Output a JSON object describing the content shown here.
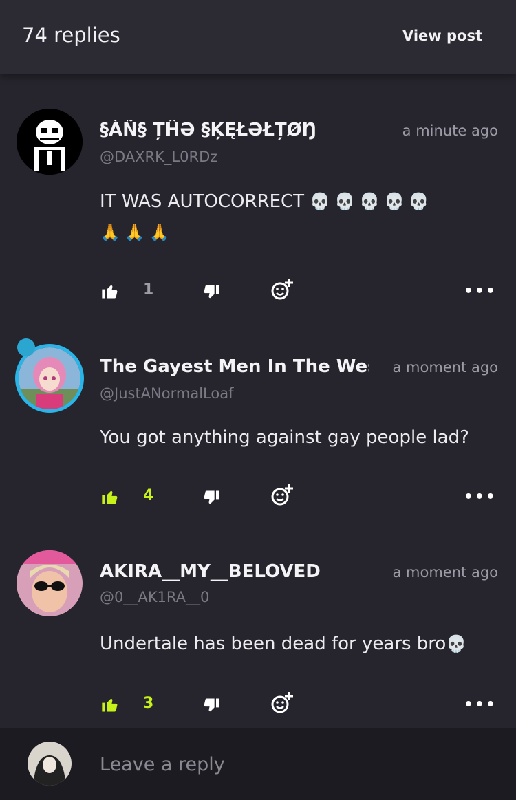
{
  "header": {
    "title": "74 replies",
    "view_post": "View post"
  },
  "comments": [
    {
      "name": "§ÀÑ§ ȚĤƏ §ĶĘŁƏŁȚØŊ",
      "handle": "@DAXRK_L0RDz",
      "time": "a minute ago",
      "text": "IT WAS AUTOCORRECT",
      "emojis_line1": [
        "💀",
        "💀",
        "💀",
        "💀",
        "💀"
      ],
      "emojis_line2": [
        "🙏",
        "🙏",
        "🙏"
      ],
      "likes": "1",
      "liked": false
    },
    {
      "name": "The Gayest Men In The West",
      "handle": "@JustANormalLoaf",
      "time": "a moment ago",
      "text": "You got anything against gay people lad?",
      "likes": "4",
      "liked": true
    },
    {
      "name": "AKIRA__MY__BELOVED",
      "handle": "@0__AK1RA__0",
      "time": "a moment ago",
      "text": "Undertale has been dead for years bro",
      "emoji_trailing": "💀",
      "likes": "3",
      "liked": true
    }
  ],
  "reply": {
    "placeholder": "Leave a reply"
  },
  "colors": {
    "background": "#26252d",
    "header": "#2c2b34",
    "accent_like": "#c6f21a",
    "muted": "#9d9ca6",
    "reply_bar": "#1c1b21"
  },
  "icons": [
    "thumbs-up-icon",
    "thumbs-down-icon",
    "add-reaction-icon",
    "more-icon",
    "pin-icon"
  ]
}
